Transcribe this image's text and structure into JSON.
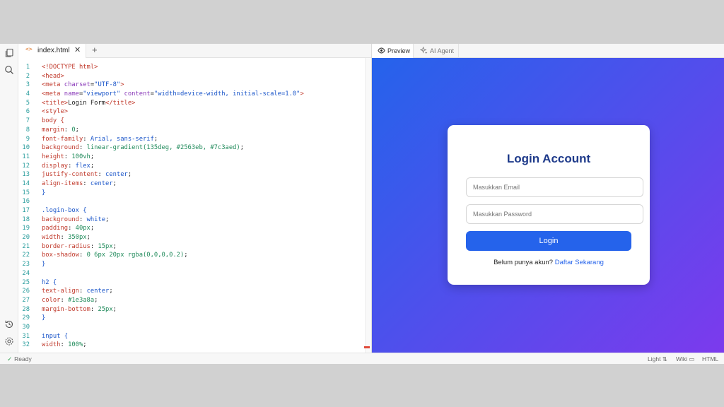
{
  "editor": {
    "tab_icon": "<>",
    "file_tab": "index.html",
    "close_glyph": "✕",
    "add_glyph": "+",
    "lines": [
      {
        "n": "1",
        "parts": [
          {
            "t": "<!DOCTYPE html>",
            "c": "tag"
          }
        ]
      },
      {
        "n": "2",
        "parts": [
          {
            "t": "<head>",
            "c": "tag"
          }
        ]
      },
      {
        "n": "3",
        "parts": [
          {
            "t": "<meta ",
            "c": "tag"
          },
          {
            "t": "charset",
            "c": "attr"
          },
          {
            "t": "=",
            "c": "plain"
          },
          {
            "t": "\"UTF-8\"",
            "c": "str"
          },
          {
            "t": ">",
            "c": "tag"
          }
        ]
      },
      {
        "n": "4",
        "parts": [
          {
            "t": "<meta ",
            "c": "tag"
          },
          {
            "t": "name",
            "c": "attr"
          },
          {
            "t": "=",
            "c": "plain"
          },
          {
            "t": "\"viewport\"",
            "c": "str"
          },
          {
            "t": " content",
            "c": "attr"
          },
          {
            "t": "=",
            "c": "plain"
          },
          {
            "t": "\"width=device-width, initial-scale=1.0\"",
            "c": "str"
          },
          {
            "t": ">",
            "c": "tag"
          }
        ]
      },
      {
        "n": "5",
        "parts": [
          {
            "t": "<title>",
            "c": "tag"
          },
          {
            "t": "Login Form",
            "c": "plain"
          },
          {
            "t": "</title>",
            "c": "tag"
          }
        ]
      },
      {
        "n": "6",
        "parts": [
          {
            "t": "<style>",
            "c": "tag"
          }
        ]
      },
      {
        "n": "7",
        "parts": [
          {
            "t": "body {",
            "c": "prop"
          }
        ]
      },
      {
        "n": "8",
        "parts": [
          {
            "t": "margin",
            "c": "prop"
          },
          {
            "t": ": ",
            "c": "plain"
          },
          {
            "t": "0",
            "c": "val"
          },
          {
            "t": ";",
            "c": "plain"
          }
        ]
      },
      {
        "n": "9",
        "parts": [
          {
            "t": "font-family",
            "c": "prop"
          },
          {
            "t": ": ",
            "c": "plain"
          },
          {
            "t": "Arial, sans-serif",
            "c": "sel"
          },
          {
            "t": ";",
            "c": "plain"
          }
        ]
      },
      {
        "n": "10",
        "parts": [
          {
            "t": "background",
            "c": "prop"
          },
          {
            "t": ": ",
            "c": "plain"
          },
          {
            "t": "linear-gradient(135deg, #2563eb, #7c3aed)",
            "c": "val"
          },
          {
            "t": ";",
            "c": "plain"
          }
        ]
      },
      {
        "n": "11",
        "parts": [
          {
            "t": "height",
            "c": "prop"
          },
          {
            "t": ": ",
            "c": "plain"
          },
          {
            "t": "100vh",
            "c": "val"
          },
          {
            "t": ";",
            "c": "plain"
          }
        ]
      },
      {
        "n": "12",
        "parts": [
          {
            "t": "display",
            "c": "prop"
          },
          {
            "t": ": ",
            "c": "plain"
          },
          {
            "t": "flex",
            "c": "sel"
          },
          {
            "t": ";",
            "c": "plain"
          }
        ]
      },
      {
        "n": "13",
        "parts": [
          {
            "t": "justify-content",
            "c": "prop"
          },
          {
            "t": ": ",
            "c": "plain"
          },
          {
            "t": "center",
            "c": "sel"
          },
          {
            "t": ";",
            "c": "plain"
          }
        ]
      },
      {
        "n": "14",
        "parts": [
          {
            "t": "align-items",
            "c": "prop"
          },
          {
            "t": ": ",
            "c": "plain"
          },
          {
            "t": "center",
            "c": "sel"
          },
          {
            "t": ";",
            "c": "plain"
          }
        ]
      },
      {
        "n": "15",
        "parts": [
          {
            "t": "}",
            "c": "sel"
          }
        ]
      },
      {
        "n": "16",
        "parts": []
      },
      {
        "n": "17",
        "parts": [
          {
            "t": ".login-box {",
            "c": "sel"
          }
        ]
      },
      {
        "n": "18",
        "parts": [
          {
            "t": "background",
            "c": "prop"
          },
          {
            "t": ": ",
            "c": "plain"
          },
          {
            "t": "white",
            "c": "sel"
          },
          {
            "t": ";",
            "c": "plain"
          }
        ]
      },
      {
        "n": "19",
        "parts": [
          {
            "t": "padding",
            "c": "prop"
          },
          {
            "t": ": ",
            "c": "plain"
          },
          {
            "t": "40px",
            "c": "val"
          },
          {
            "t": ";",
            "c": "plain"
          }
        ]
      },
      {
        "n": "20",
        "parts": [
          {
            "t": "width",
            "c": "prop"
          },
          {
            "t": ": ",
            "c": "plain"
          },
          {
            "t": "350px",
            "c": "val"
          },
          {
            "t": ";",
            "c": "plain"
          }
        ]
      },
      {
        "n": "21",
        "parts": [
          {
            "t": "border-radius",
            "c": "prop"
          },
          {
            "t": ": ",
            "c": "plain"
          },
          {
            "t": "15px",
            "c": "val"
          },
          {
            "t": ";",
            "c": "plain"
          }
        ]
      },
      {
        "n": "22",
        "parts": [
          {
            "t": "box-shadow",
            "c": "prop"
          },
          {
            "t": ": ",
            "c": "plain"
          },
          {
            "t": "0 6px 20px rgba(0,0,0,0.2)",
            "c": "val"
          },
          {
            "t": ";",
            "c": "plain"
          }
        ]
      },
      {
        "n": "23",
        "parts": [
          {
            "t": "}",
            "c": "sel"
          }
        ]
      },
      {
        "n": "24",
        "parts": []
      },
      {
        "n": "25",
        "parts": [
          {
            "t": "h2 {",
            "c": "sel"
          }
        ]
      },
      {
        "n": "26",
        "parts": [
          {
            "t": "text-align",
            "c": "prop"
          },
          {
            "t": ": ",
            "c": "plain"
          },
          {
            "t": "center",
            "c": "sel"
          },
          {
            "t": ";",
            "c": "plain"
          }
        ]
      },
      {
        "n": "27",
        "parts": [
          {
            "t": "color",
            "c": "prop"
          },
          {
            "t": ": ",
            "c": "plain"
          },
          {
            "t": "#1e3a8a",
            "c": "val"
          },
          {
            "t": ";",
            "c": "plain"
          }
        ]
      },
      {
        "n": "28",
        "parts": [
          {
            "t": "margin-bottom",
            "c": "prop"
          },
          {
            "t": ": ",
            "c": "plain"
          },
          {
            "t": "25px",
            "c": "val"
          },
          {
            "t": ";",
            "c": "plain"
          }
        ]
      },
      {
        "n": "29",
        "parts": [
          {
            "t": "}",
            "c": "sel"
          }
        ]
      },
      {
        "n": "30",
        "parts": []
      },
      {
        "n": "31",
        "parts": [
          {
            "t": "input {",
            "c": "sel"
          }
        ]
      },
      {
        "n": "32",
        "parts": [
          {
            "t": "width",
            "c": "prop"
          },
          {
            "t": ": ",
            "c": "plain"
          },
          {
            "t": "100%",
            "c": "val"
          },
          {
            "t": ";",
            "c": "plain"
          }
        ]
      }
    ]
  },
  "preview_panel": {
    "tab_preview": "Preview",
    "tab_agent": "AI Agent",
    "card": {
      "title": "Login Account",
      "email_placeholder": "Masukkan Email",
      "password_placeholder": "Masukkan Password",
      "login_label": "Login",
      "signup_text": "Belum punya akun?",
      "signup_link": "Daftar Sekarang"
    },
    "gradient": [
      "#2563eb",
      "#7c3aed"
    ]
  },
  "statusbar": {
    "check_glyph": "✓",
    "ready": "Ready",
    "theme": "Light ⇅",
    "wiki": "Wiki ▭",
    "lang": "HTML"
  },
  "icons": {
    "sidebar_top": [
      "files-icon",
      "search-icon"
    ],
    "sidebar_bottom": [
      "history-icon",
      "settings-icon"
    ]
  }
}
